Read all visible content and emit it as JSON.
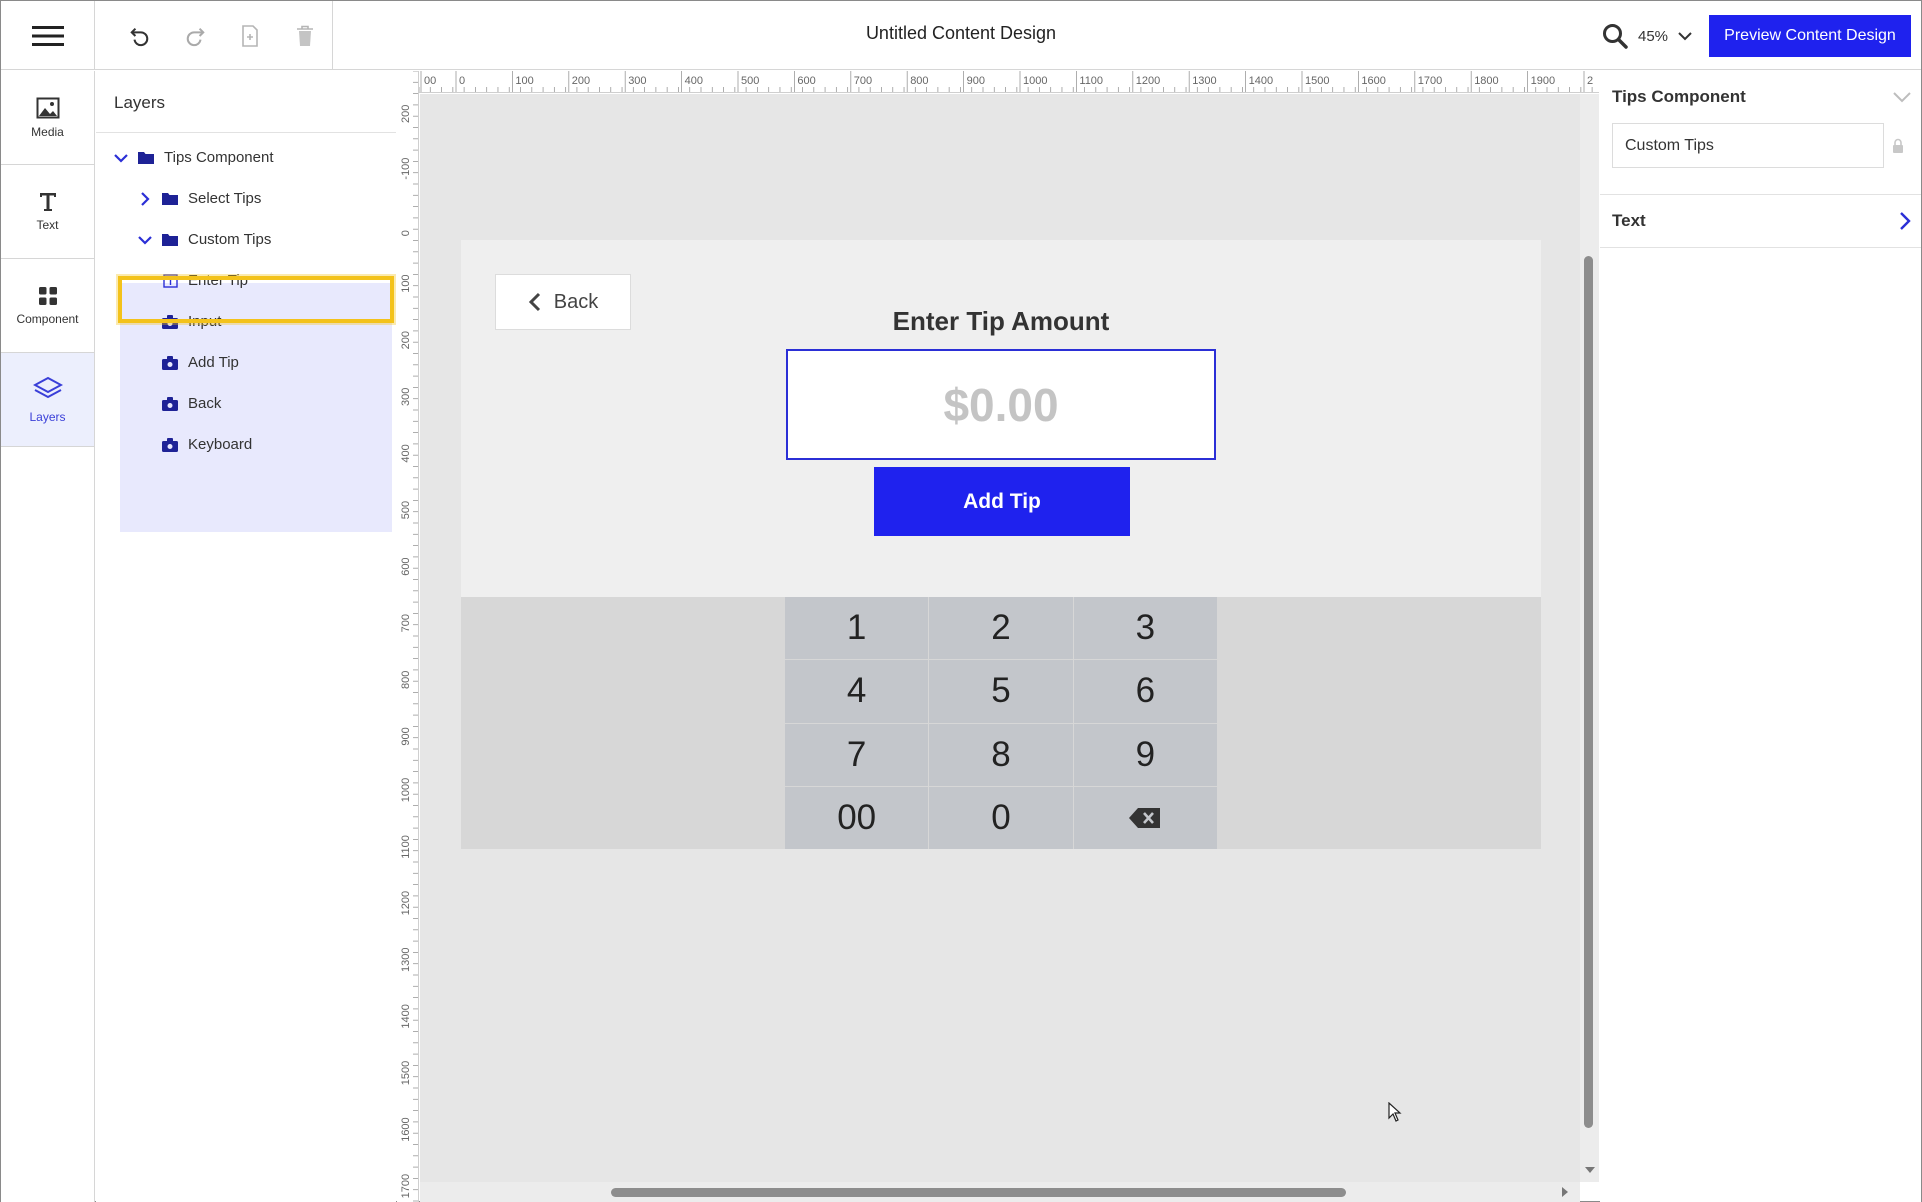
{
  "topbar": {
    "title": "Untitled Content Design",
    "zoom": "45%",
    "preview_label": "Preview Content Design"
  },
  "rail": {
    "items": [
      {
        "label": "Media",
        "icon": "image-icon"
      },
      {
        "label": "Text",
        "icon": "text-icon"
      },
      {
        "label": "Component",
        "icon": "grid-icon"
      },
      {
        "label": "Layers",
        "icon": "layers-icon"
      }
    ]
  },
  "layers": {
    "title": "Layers",
    "tree": [
      {
        "label": "Tips Component"
      },
      {
        "label": "Select Tips"
      },
      {
        "label": "Custom Tips"
      },
      {
        "label": "Enter Tip"
      },
      {
        "label": "Input"
      },
      {
        "label": "Add Tip"
      },
      {
        "label": "Back"
      },
      {
        "label": "Keyboard"
      }
    ]
  },
  "rulers": {
    "h": [
      "00",
      "0",
      "100",
      "200",
      "300",
      "400",
      "500",
      "600",
      "700",
      "800",
      "900",
      "1000",
      "1100",
      "1200",
      "1300",
      "1400",
      "1500",
      "1600",
      "1700",
      "1800",
      "1900",
      "2"
    ],
    "v": [
      "200",
      "-100",
      "0",
      "100",
      "200",
      "300",
      "400",
      "500",
      "600",
      "700",
      "800",
      "900",
      "1000",
      "1100",
      "1200",
      "1300",
      "1400",
      "1500",
      "1600",
      "1700"
    ]
  },
  "canvas": {
    "back_label": "Back",
    "enter_title": "Enter Tip Amount",
    "input_placeholder": "$0.00",
    "add_tip_label": "Add Tip",
    "keys": [
      "1",
      "2",
      "3",
      "4",
      "5",
      "6",
      "7",
      "8",
      "9",
      "00",
      "0",
      "backspace-icon"
    ]
  },
  "right_panel": {
    "section_title": "Tips Component",
    "name_value": "Custom Tips",
    "text_section": "Text"
  },
  "colors": {
    "accent": "#1f22ee",
    "highlight": "#f3c21b",
    "selection_bg": "#e8e9fd"
  }
}
